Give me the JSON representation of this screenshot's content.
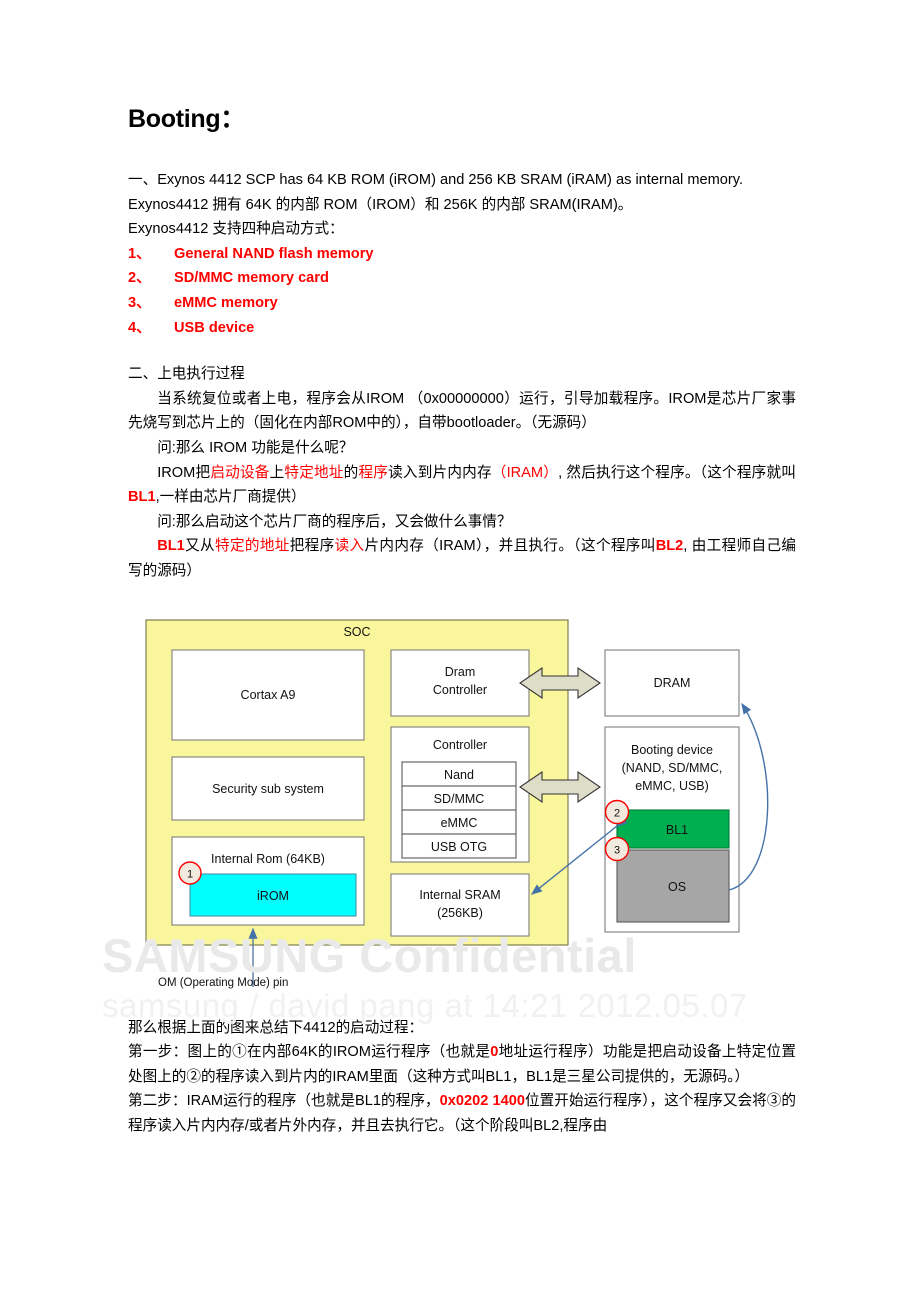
{
  "document": {
    "title": "Booting：",
    "intro": {
      "line_en": "一、Exynos 4412 SCP has 64 KB ROM (iROM) and 256 KB SRAM (iRAM) as internal memory.",
      "line_cn1": "Exynos4412 拥有  64K 的内部  ROM（IROM）和  256K 的内部  SRAM(IRAM)。",
      "line_cn2": "Exynos4412 支持四种启动方式："
    },
    "boot_modes": [
      {
        "num": "1、",
        "label": "General NAND flash memory"
      },
      {
        "num": "2、",
        "label": "SD/MMC memory card"
      },
      {
        "num": "3、",
        "label": "eMMC memory"
      },
      {
        "num": "4、",
        "label": "USB device"
      }
    ],
    "section2_heading": "二、上电执行过程",
    "p1": {
      "a": "当系统复位或者上电，程序会从IROM  （0x00000000）运行，引导加载程序。IROM是芯片厂家事先烧写到芯片上的（固化在内部ROM中的），自带bootloader。（无源码）"
    },
    "q1": "问:那么  IROM 功能是什么呢？",
    "p2": {
      "a": "IROM把",
      "r1": "启动设备",
      "b": "上",
      "r2": "特定地址",
      "c": "的",
      "r3": "程序",
      "d": "读入到片内内存",
      "r4": "（IRAM）",
      "e": ", 然后执行这个程序。（这个程序就叫",
      "r5": "BL1",
      "f": ",一样由芯片厂商提供）"
    },
    "q2": "问:那么启动这个芯片厂商的程序后，又会做什么事情？",
    "p3": {
      "r1": "BL1",
      "a": "又从",
      "r2": "特定的地址",
      "b": "把程序",
      "r3": "读入",
      "c": "片内内存（IRAM），并且执行。（这个程序叫",
      "r4": "BL2",
      "d": ", 由工程师自己编写的源码）"
    },
    "summary_heading": "那么根据上面的图来总结下4412的启动过程：",
    "step1": {
      "a": "第一步：图上的①在内部64K的IROM运行程序（也就是",
      "r1": "0",
      "b": "地址运行程序）功能是把启动设备上特定位置处图上的②的程序读入到片内的IRAM里面（这种方式叫BL1，BL1是三星公司提供的，无源码。）"
    },
    "step2": {
      "a": "第二步：IRAM运行的程序（也就是BL1的程序，",
      "r1": "0x0202 1400",
      "b": "位置开始运行程序），这个程序又会将③的程序读入片内内存/或者片外内存，并且去执行它。（这个阶段叫BL2,程序由"
    }
  },
  "figure": {
    "soc_label": "SOC",
    "blocks": {
      "cortex": "Cortax A9",
      "security": "Security sub system",
      "internal_rom": "Internal Rom (64KB)",
      "irom": "iROM",
      "dram_controller_l1": "Dram",
      "dram_controller_l2": "Controller",
      "controller": "Controller",
      "nand": "Nand",
      "sdmmc": "SD/MMC",
      "emmc": "eMMC",
      "usbotg": "USB OTG",
      "internal_sram_l1": "Internal SRAM",
      "internal_sram_l2": "(256KB)",
      "dram": "DRAM",
      "booting_device_l1": "Booting device",
      "booting_device_l2": "(NAND, SD/MMC,",
      "booting_device_l3": "eMMC, USB)",
      "bl1": "BL1",
      "os": "OS"
    },
    "markers": {
      "m1": "1",
      "m2": "2",
      "m3": "3"
    },
    "om_pin": "OM (Operating Mode) pin",
    "watermark_line1": "SAMSUNG Confidential",
    "watermark_line2": "samsung / david pang at 14:21 2012.05.07",
    "colors": {
      "soc_fill": "#faf69b",
      "irom_fill": "#00ffff",
      "bl1_fill": "#00b050",
      "os_fill": "#a6a6a6",
      "arrow_fill": "#ddddc8",
      "marker_fill": "#f2eade",
      "marker_stroke": "#ff0000",
      "blue_arrow": "#4472a8",
      "box_stroke": "#808080"
    }
  }
}
